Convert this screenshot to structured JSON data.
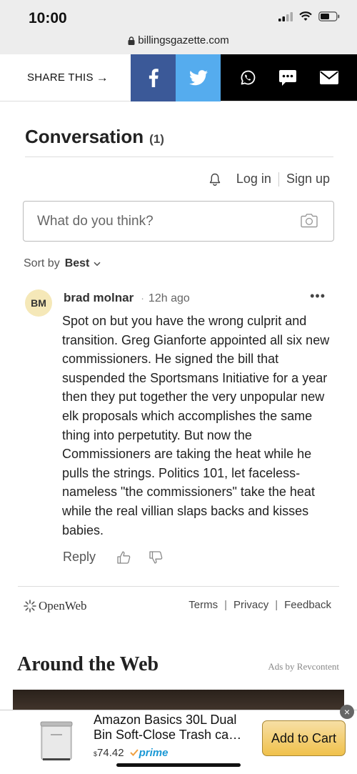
{
  "status": {
    "time": "10:00"
  },
  "browser": {
    "url": "billingsgazette.com"
  },
  "share": {
    "label": "SHARE THIS",
    "arrow": "→",
    "buttons": [
      "facebook-icon",
      "twitter-icon",
      "whatsapp-icon",
      "sms-icon",
      "email-icon"
    ],
    "colors": {
      "facebook": "#3b5998",
      "twitter": "#55acee",
      "other": "#000000"
    }
  },
  "conversation": {
    "title": "Conversation",
    "count": "(1)",
    "login": "Log in",
    "signup": "Sign up",
    "input_placeholder": "What do you think?",
    "sort_label": "Sort by",
    "sort_value": "Best"
  },
  "comment": {
    "initials": "BM",
    "author": "brad molnar",
    "dot": "·",
    "time": "12h ago",
    "more": "•••",
    "body": "Spot on but you have the wrong culprit and transition. Greg Gianforte appointed all six new commissioners. He signed the bill that suspended the Sportsmans Initiative for a year then they put together the very unpopular new elk proposals which accomplishes the same thing into perpetutity. But now the Commissioners are taking the heat while he pulls the strings. Politics 101, let faceless-nameless \"the commissioners\" take the heat while the real villian slaps backs and kisses babies.",
    "reply": "Reply"
  },
  "footer": {
    "brand": "OpenWeb",
    "links": [
      "Terms",
      "Privacy",
      "Feedback"
    ],
    "sep": "|"
  },
  "around": {
    "title": "Around the Web",
    "ads_by": "Ads by Revcontent"
  },
  "ad": {
    "close": "×",
    "title_line1": "Amazon Basics 30L Dual",
    "title_line2": "Bin Soft-Close Trash ca…",
    "currency": "$",
    "price": "74.42",
    "prime": "prime",
    "button": "Add to Cart"
  }
}
